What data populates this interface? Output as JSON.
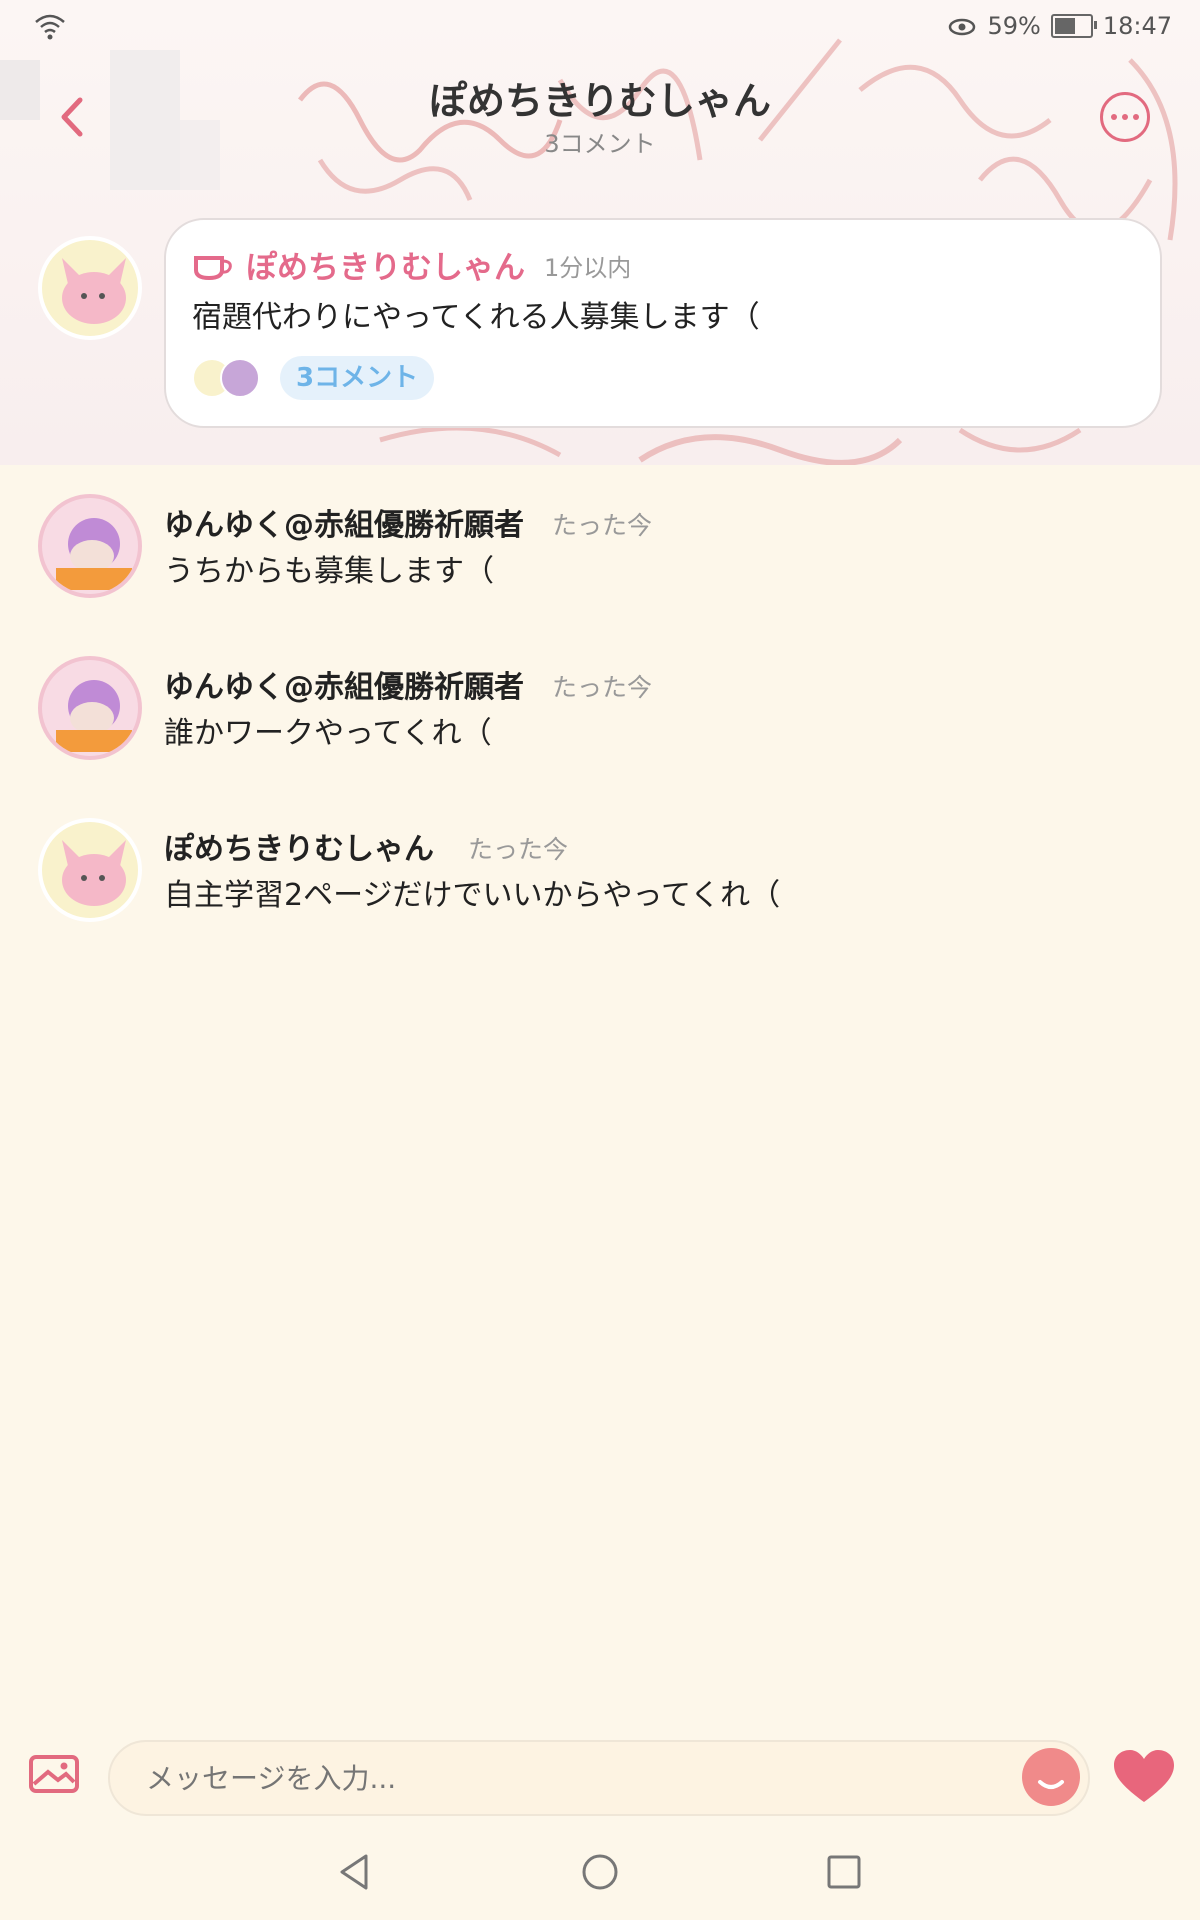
{
  "status_bar": {
    "battery_pct": "59%",
    "time": "18:47",
    "battery_level": 0.59
  },
  "header": {
    "title": "ぽめちきりむしゃん",
    "subtitle": "3コメント"
  },
  "post": {
    "author": "ぽめちきりむしゃん",
    "time": "1分以内",
    "text": "宿題代わりにやってくれる人募集します（",
    "comment_pill": "3コメント"
  },
  "comments": [
    {
      "name": "ゆんゆく@赤組優勝祈願者",
      "time": "たった今",
      "text": "うちからも募集します（"
    },
    {
      "name": "ゆんゆく@赤組優勝祈願者",
      "time": "たった今",
      "text": "誰かワークやってくれ（"
    },
    {
      "name": "ぽめちきりむしゃん",
      "time": "たった今",
      "text": "自主学習2ページだけでいいからやってくれ（"
    }
  ],
  "input": {
    "placeholder": "メッセージを入力..."
  },
  "colors": {
    "accent": "#e26a7f",
    "background": "#fdf7ea",
    "pill": "#6eb4e8"
  }
}
